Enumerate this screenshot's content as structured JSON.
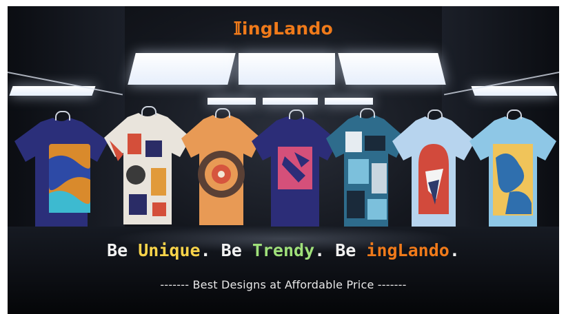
{
  "brand": {
    "logo_glyph": "𝕀",
    "logo_text": "ingLando"
  },
  "tagline": {
    "be1": "Be ",
    "unique": "Unique",
    "sep1": ". ",
    "be2": "Be ",
    "trendy": "Trendy",
    "sep2": ". ",
    "be3": "Be ",
    "brand": "ingLando",
    "end": "."
  },
  "subline": "------- Best Designs at Affordable Price -------",
  "colors": {
    "brand_orange": "#f07a1a",
    "unique_yellow": "#f7d34a",
    "trendy_green": "#9fe07a"
  },
  "shirts": [
    {
      "name": "navy-wave-tshirt",
      "base": "#2b2f7a"
    },
    {
      "name": "geometric-print-tshirt",
      "base": "#e9e4dc"
    },
    {
      "name": "orange-circle-tshirt",
      "base": "#e89a55"
    },
    {
      "name": "navy-pink-square-tshirt",
      "base": "#2c2d78"
    },
    {
      "name": "blue-collage-tshirt",
      "base": "#2e6c8c"
    },
    {
      "name": "light-blue-arch-tshirt",
      "base": "#b7d4ee"
    },
    {
      "name": "sky-blue-abstract-tshirt",
      "base": "#8ec7e6"
    }
  ]
}
